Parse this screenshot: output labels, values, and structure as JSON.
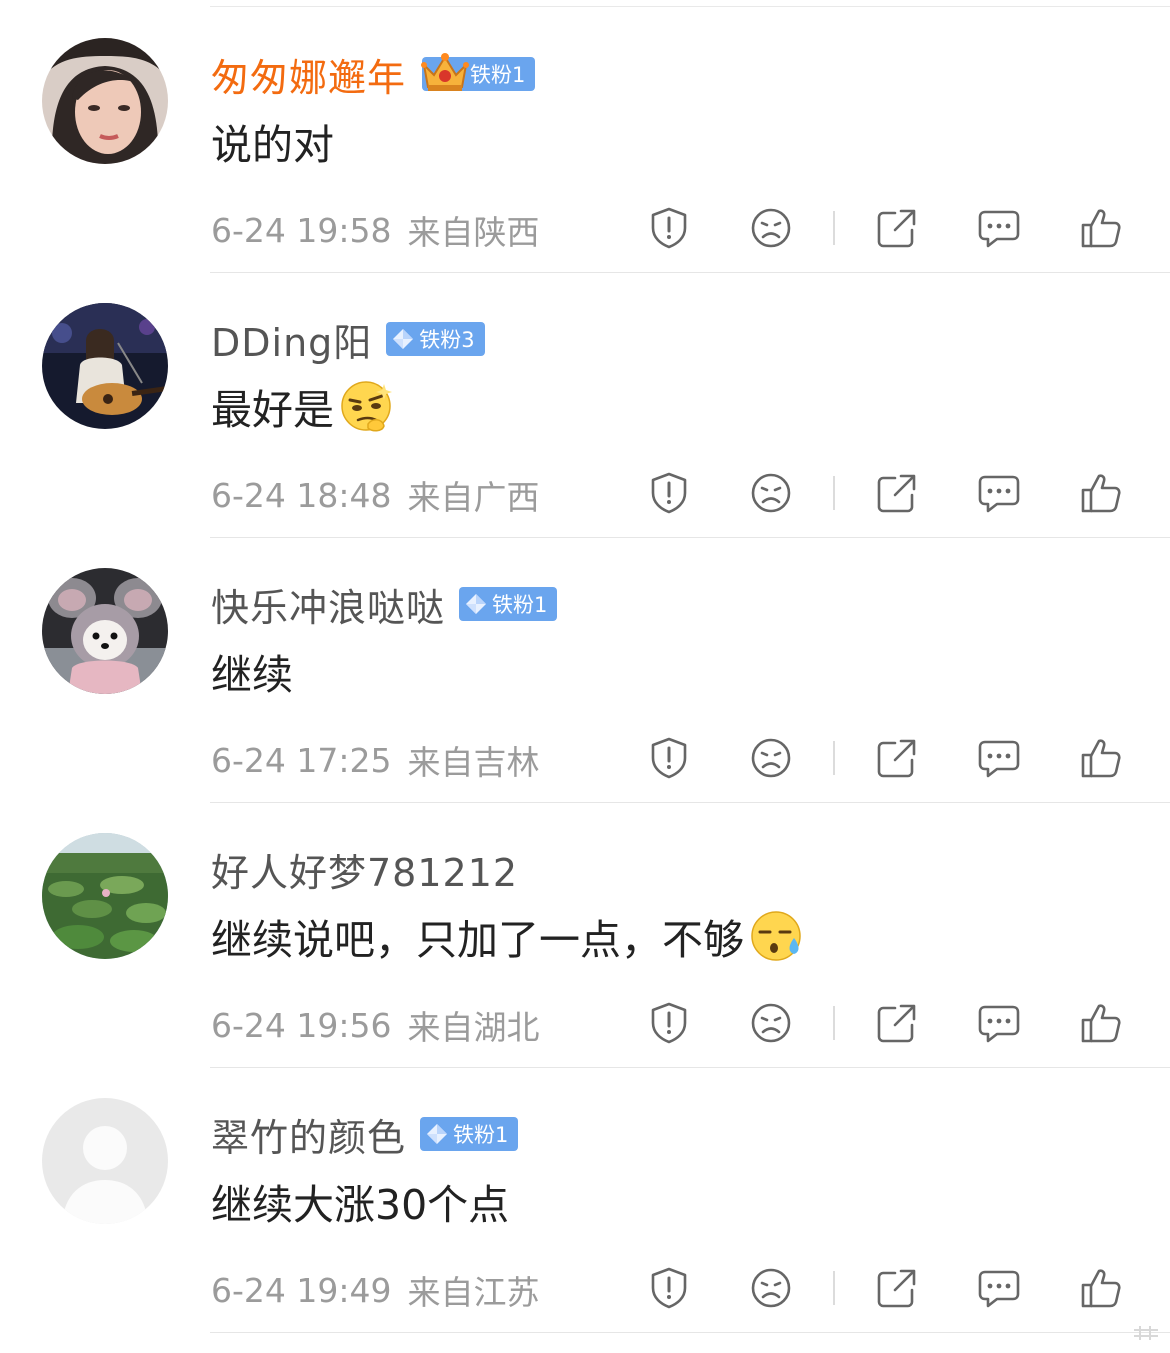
{
  "colors": {
    "vip_name": "#f36b10",
    "name": "#555555",
    "badge": "#6aa5ee",
    "meta": "#9b9b9b"
  },
  "comments": [
    {
      "username": "匆匆娜邂年",
      "vip": true,
      "badge": "铁粉1",
      "text": "说的对",
      "emoji": null,
      "time": "6-24 19:58",
      "location": "来自陕西",
      "avatar": "woman-portrait"
    },
    {
      "username": "DDing阳",
      "vip": false,
      "badge": "铁粉3",
      "text": "最好是",
      "emoji": "thinking-emoji",
      "time": "6-24 18:48",
      "location": "来自广西",
      "avatar": "guitar-singer"
    },
    {
      "username": "快乐冲浪哒哒",
      "vip": false,
      "badge": "铁粉1",
      "text": "继续",
      "emoji": null,
      "time": "6-24 17:25",
      "location": "来自吉林",
      "avatar": "dog-in-hood"
    },
    {
      "username": "好人好梦781212",
      "vip": false,
      "badge": null,
      "text": "继续说吧，只加了一点，不够",
      "emoji": "sweat-emoji",
      "time": "6-24 19:56",
      "location": "来自湖北",
      "avatar": "lotus-pond"
    },
    {
      "username": "翠竹的颜色",
      "vip": false,
      "badge": "铁粉1",
      "text": "继续大涨30个点",
      "emoji": null,
      "time": "6-24 19:49",
      "location": "来自江苏",
      "avatar": "default-avatar"
    }
  ],
  "actions": [
    "report-icon",
    "dislike-icon",
    "share-icon",
    "reply-icon",
    "like-icon"
  ]
}
